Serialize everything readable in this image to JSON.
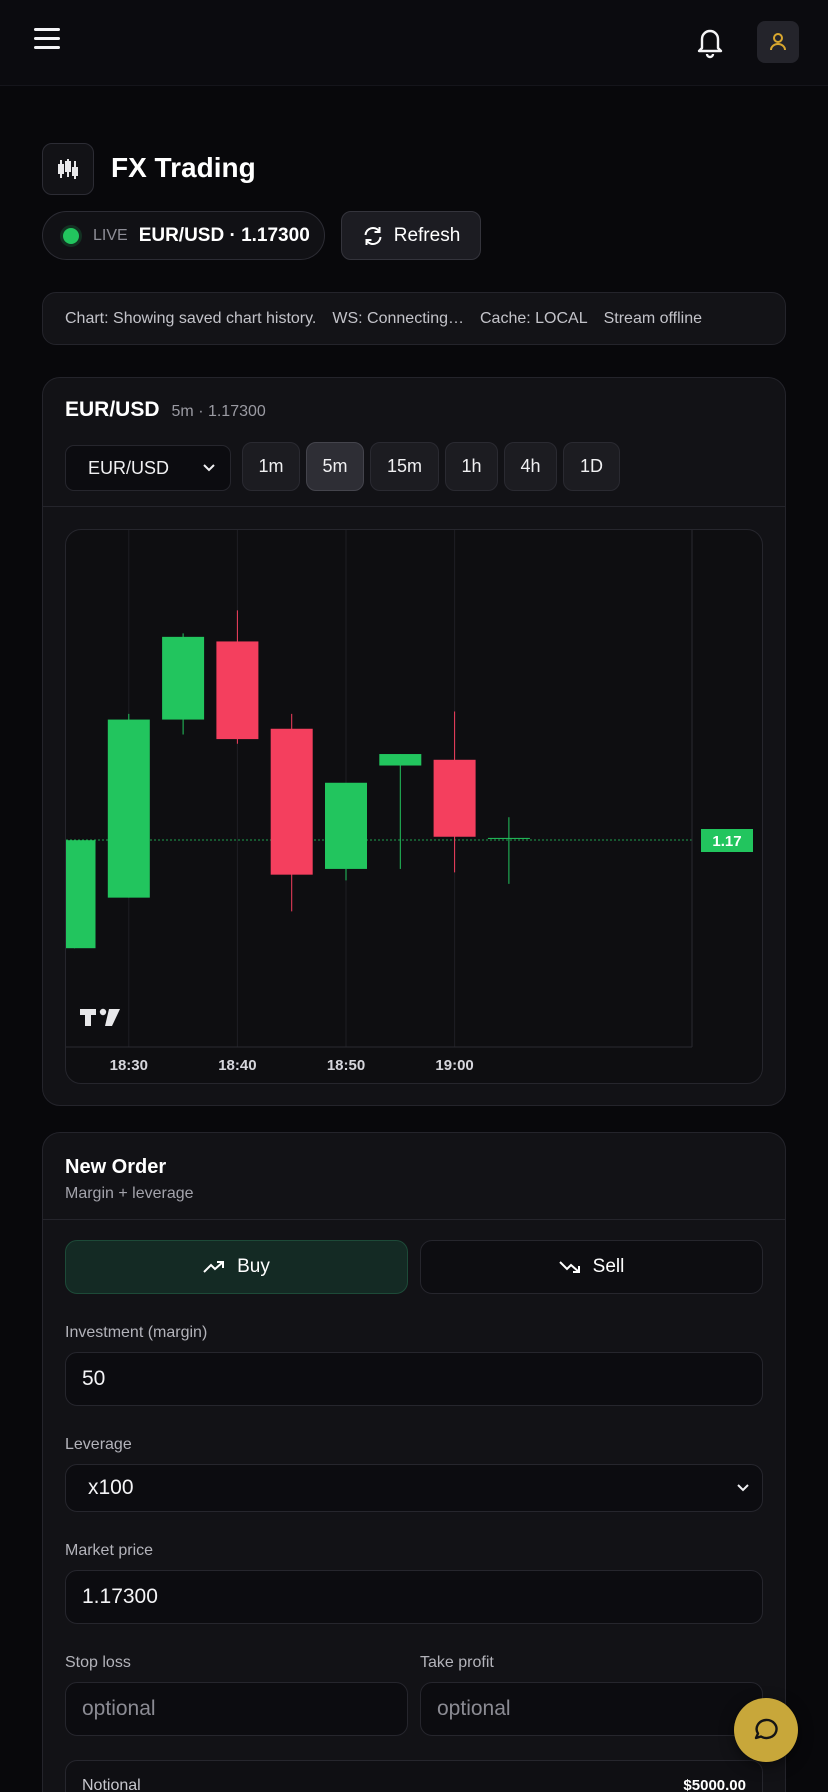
{
  "app": {
    "title": "FX Trading"
  },
  "header": {
    "live_label": "LIVE",
    "live_pair": "EUR/USD · 1.17300",
    "refresh_label": "Refresh"
  },
  "status": {
    "chart": "Chart: Showing saved chart history.",
    "ws": "WS: Connecting…",
    "cache": "Cache: LOCAL",
    "stream": "Stream offline"
  },
  "chart": {
    "pair": "EUR/USD",
    "sub": "5m · 1.17300",
    "select_value": "EUR/USD",
    "timeframes": [
      "1m",
      "5m",
      "15m",
      "1h",
      "4h",
      "1D"
    ],
    "active_timeframe": "5m",
    "price_label": "1.17",
    "time_labels": [
      "18:30",
      "18:40",
      "18:50",
      "19:00"
    ]
  },
  "chart_data": {
    "type": "candlestick",
    "title": "",
    "xlabel": "",
    "ylabel": "",
    "x_tick_labels": [
      "18:30",
      "18:40",
      "18:50",
      "19:00"
    ],
    "current_price": 1.17,
    "current_price_label": "1.17",
    "up_color": "#22c55e",
    "down_color": "#f43f5e",
    "candles": [
      {
        "time": "18:25",
        "open": 1.16986,
        "high": 1.1708,
        "low": 1.16986,
        "close": 1.1708
      },
      {
        "time": "18:30",
        "open": 1.1703,
        "high": 1.1719,
        "low": 1.1703,
        "close": 1.17185
      },
      {
        "time": "18:35",
        "open": 1.17185,
        "high": 1.1726,
        "low": 1.17172,
        "close": 1.17257
      },
      {
        "time": "18:40",
        "open": 1.17253,
        "high": 1.1728,
        "low": 1.17164,
        "close": 1.17168
      },
      {
        "time": "18:45",
        "open": 1.17177,
        "high": 1.1719,
        "low": 1.17018,
        "close": 1.1705
      },
      {
        "time": "18:50",
        "open": 1.17055,
        "high": 1.17055,
        "low": 1.17045,
        "close": 1.1713
      },
      {
        "time": "18:55",
        "open": 1.17145,
        "high": 1.17155,
        "low": 1.17055,
        "close": 1.17155
      },
      {
        "time": "19:00",
        "open": 1.1715,
        "high": 1.17192,
        "low": 1.17052,
        "close": 1.17083
      },
      {
        "time": "19:05",
        "open": 1.17082,
        "high": 1.171,
        "low": 1.17042,
        "close": 1.17082
      }
    ]
  },
  "order": {
    "title": "New Order",
    "subtitle": "Margin + leverage",
    "buy_label": "Buy",
    "sell_label": "Sell",
    "investment_label": "Investment (margin)",
    "investment_value": "50",
    "leverage_label": "Leverage",
    "leverage_value": "x100",
    "market_price_label": "Market price",
    "market_price_value": "1.17300",
    "stop_loss_label": "Stop loss",
    "stop_loss_placeholder": "optional",
    "take_profit_label": "Take profit",
    "take_profit_placeholder": "optional",
    "notional_label": "Notional",
    "notional_value": "$5000.00"
  },
  "icons": [
    "menu-icon",
    "bell-icon",
    "user-icon",
    "candlestick-icon",
    "refresh-icon",
    "chevron-down-icon",
    "trend-up-icon",
    "trend-down-icon",
    "chat-icon",
    "tradingview-logo"
  ],
  "colors": {
    "accent": "#c8a73a",
    "up": "#22c55e",
    "down": "#f43f5e",
    "background": "#08080b"
  }
}
